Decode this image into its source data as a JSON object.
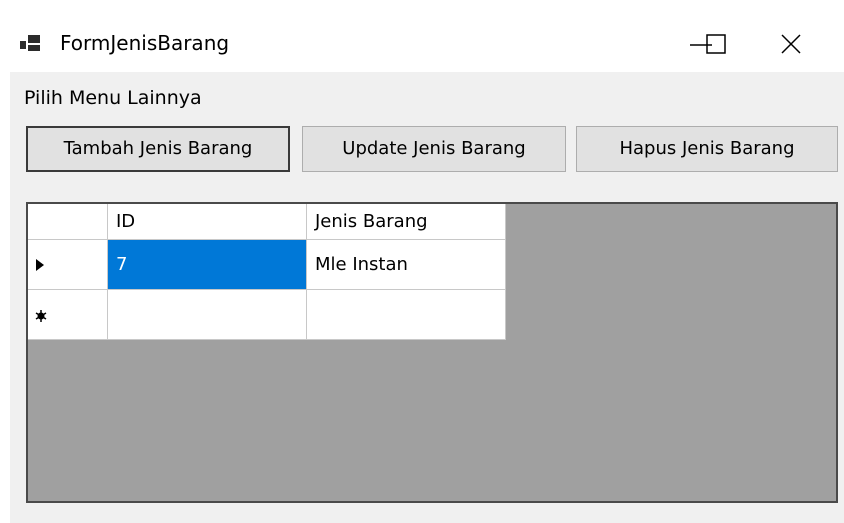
{
  "window": {
    "title": "FormJenisBarang",
    "icon": "winforms-app-icon",
    "controls": [
      "minimize-icon",
      "maximize-icon",
      "close-icon"
    ]
  },
  "menu": {
    "items": [
      {
        "label": "Pilih Menu Lainnya"
      }
    ]
  },
  "toolbar": {
    "add_label": "Tambah Jenis Barang",
    "update_label": "Update Jenis Barang",
    "delete_label": "Hapus Jenis Barang"
  },
  "grid": {
    "columns": [
      "ID",
      "Jenis Barang"
    ],
    "rows": [
      {
        "indicator": "current-row-arrow-icon",
        "id": "7",
        "jenis_barang": "Mle Instan",
        "selected_cell": "id"
      },
      {
        "indicator": "new-row-asterisk-icon",
        "id": "",
        "jenis_barang": ""
      }
    ],
    "colors": {
      "background": "#a0a0a0",
      "selection": "#0078d7"
    }
  }
}
